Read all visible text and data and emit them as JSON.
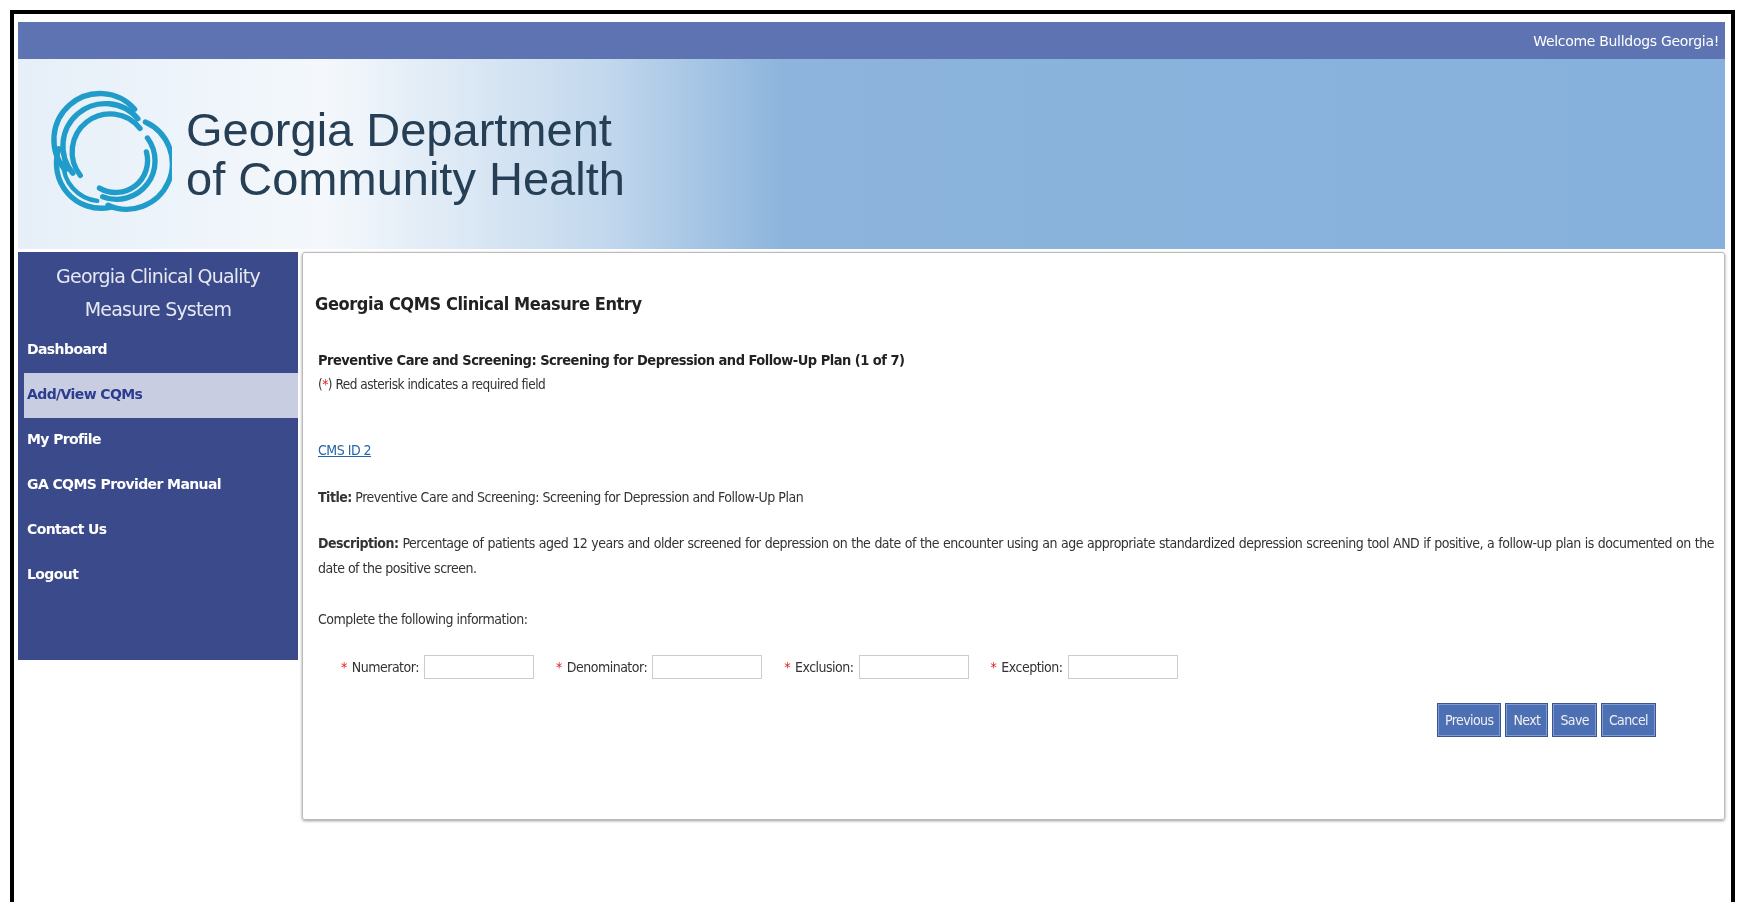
{
  "top_bar": {
    "welcome": "Welcome Bulldogs Georgia!"
  },
  "header": {
    "title_line1": "Georgia Department",
    "title_line2": "of Community Health"
  },
  "sidebar": {
    "title": "Georgia Clinical Quality Measure System",
    "items": [
      {
        "label": "Dashboard",
        "selected": false
      },
      {
        "label": "Add/View CQMs",
        "selected": true
      },
      {
        "label": "My Profile",
        "selected": false
      },
      {
        "label": "GA CQMS Provider Manual",
        "selected": false
      },
      {
        "label": "Contact Us",
        "selected": false
      },
      {
        "label": "Logout",
        "selected": false
      }
    ]
  },
  "main": {
    "heading": "Georgia CQMS Clinical Measure Entry",
    "measure_heading": "Preventive Care and Screening: Screening for Depression and Follow-Up Plan (1 of 7)",
    "legend": {
      "open": "(",
      "mark": "*",
      "text": ") Red asterisk indicates a required field"
    },
    "cms_link": "CMS ID 2",
    "title": "**Title:** Preventive Care and Screening: Screening for Depression and Follow-Up Plan",
    "description": "**Description:** Percentage of patients aged 12 years and older screened for depression on the date of the encounter using an age appropriate standardized depression screening tool AND if positive, a follow-up plan is documented on the date of the positive screen.",
    "instruction": "Complete the following information:",
    "fields": [
      {
        "label": "Numerator:",
        "required": true,
        "mark": "*"
      },
      {
        "label": "Denominator:",
        "required": true,
        "mark": "*"
      },
      {
        "label": "Exclusion:",
        "required": true,
        "mark": "*"
      },
      {
        "label": "Exception:",
        "required": true,
        "mark": "*"
      }
    ],
    "buttons": [
      "Previous",
      "Next",
      "Save",
      "Cancel"
    ]
  }
}
